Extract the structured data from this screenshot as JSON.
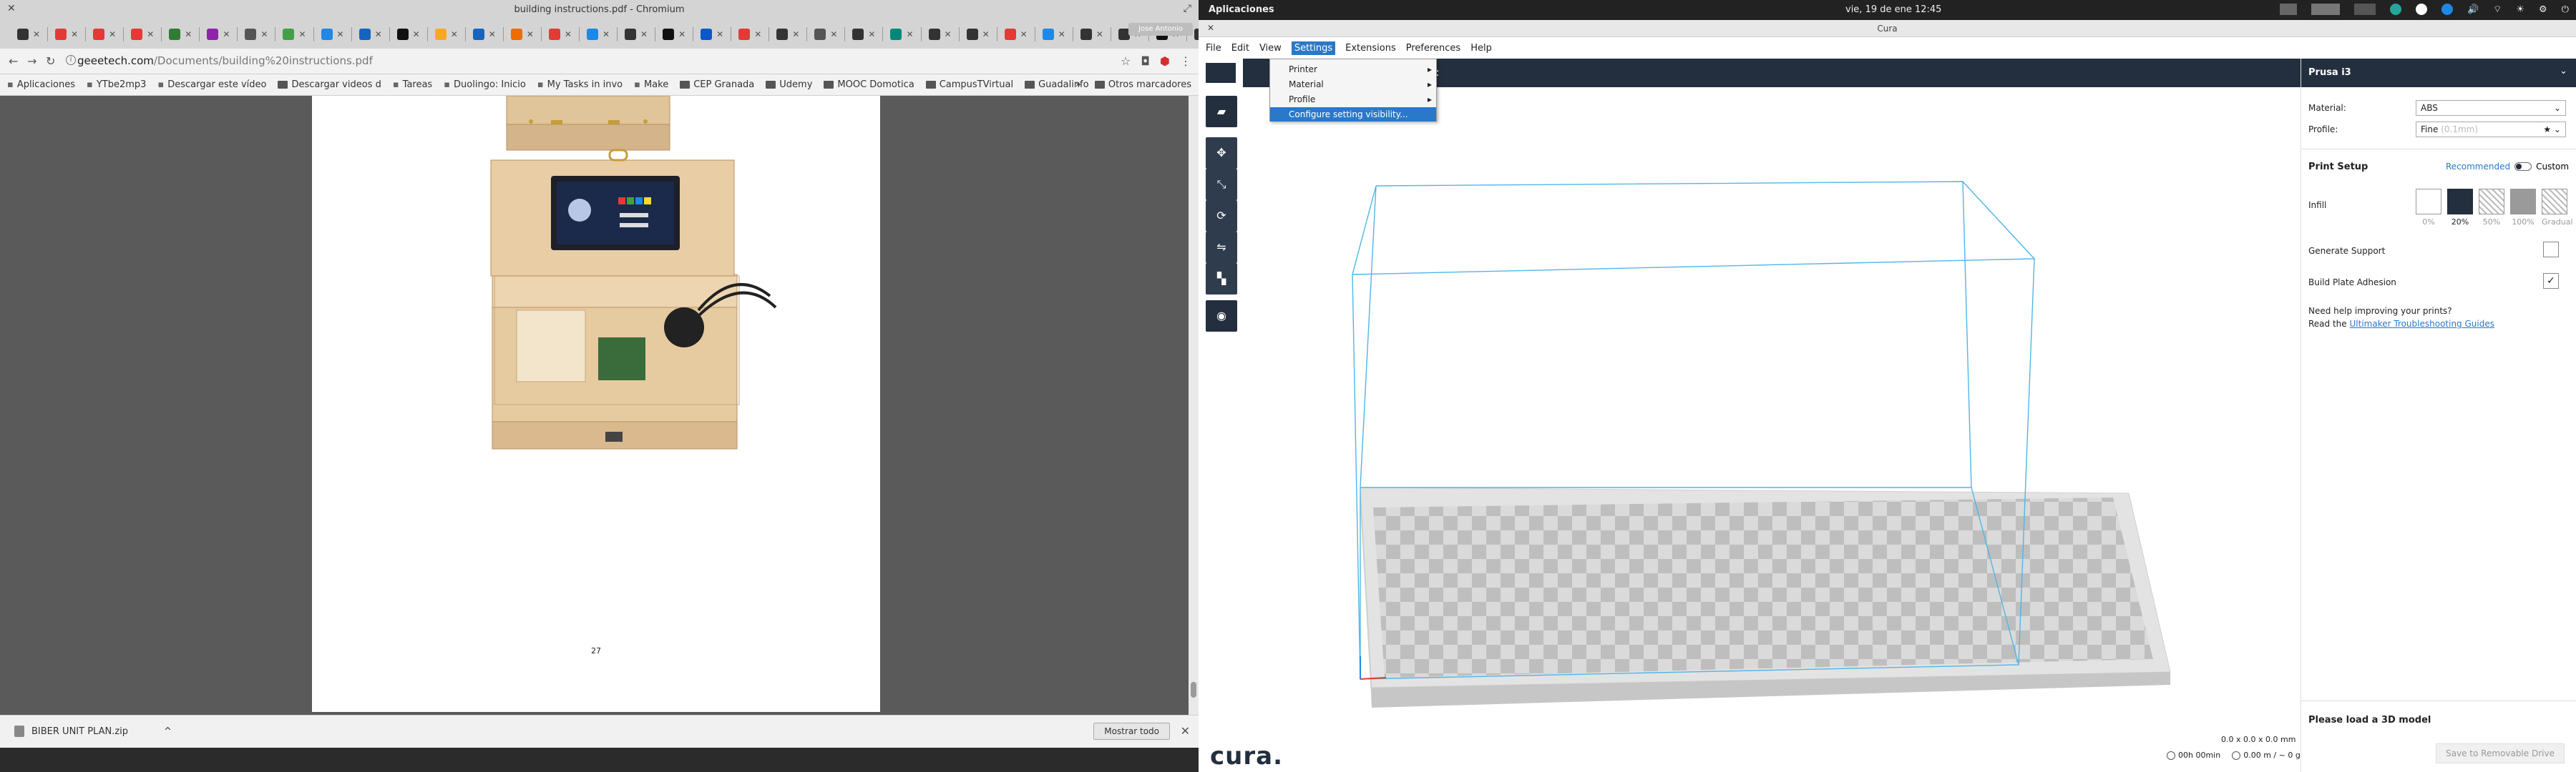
{
  "browser": {
    "window_title": "building instructions.pdf - Chromium",
    "user_label": "Jose Antonio",
    "url_host": "geeetech.com",
    "url_path": "/Documents/building%20instructions.pdf",
    "bookmarks": [
      {
        "label": "Aplicaciones",
        "icon": "apps-icon"
      },
      {
        "label": "YTbe2mp3",
        "icon": "page-icon"
      },
      {
        "label": "Descargar este vídeo",
        "icon": "page-icon"
      },
      {
        "label": "Descargar videos d",
        "icon": "folder-icon"
      },
      {
        "label": "Tareas",
        "icon": "check-icon"
      },
      {
        "label": "Duolingo: Inicio",
        "icon": "duolingo-icon"
      },
      {
        "label": "My Tasks in invo",
        "icon": "tasks-icon"
      },
      {
        "label": "Make",
        "icon": "make-icon"
      },
      {
        "label": "CEP Granada",
        "icon": "folder-icon"
      },
      {
        "label": "Udemy",
        "icon": "folder-icon"
      },
      {
        "label": "MOOC Domotica",
        "icon": "folder-icon"
      },
      {
        "label": "CampusTVirtual",
        "icon": "folder-icon"
      },
      {
        "label": "Guadalinfo",
        "icon": "folder-icon"
      }
    ],
    "other_bookmarks": "Otros marcadores",
    "page_number": "27",
    "download_file": "BIBER UNIT PLAN.zip",
    "show_all": "Mostrar todo",
    "tab_colors": [
      "#333333",
      "#e53935",
      "#e53935",
      "#e53935",
      "#2e7d32",
      "#8e24aa",
      "#555555",
      "#43a047",
      "#1e88e5",
      "#1565c0",
      "#111111",
      "#f9a825",
      "#1565c0",
      "#ef6c00",
      "#e53935",
      "#1e88e5",
      "#333333",
      "#111111",
      "#0b57d0",
      "#e53935",
      "#333333",
      "#555555",
      "#333333",
      "#00897b",
      "#333333",
      "#333333",
      "#e53935",
      "#1e88e5",
      "#333333",
      "#333333",
      "#111111",
      "#333333",
      "#e53935",
      "#e53935",
      "#e53935"
    ]
  },
  "system": {
    "apps_menu": "Aplicaciones",
    "clock": "vie, 19 de ene   12:45"
  },
  "cura": {
    "window_title": "Cura",
    "menu": [
      "File",
      "Edit",
      "View",
      "Settings",
      "Extensions",
      "Preferences",
      "Help"
    ],
    "header_tab": "nt",
    "settings_menu": [
      {
        "label": "Printer",
        "has_sub": true
      },
      {
        "label": "Material",
        "has_sub": true
      },
      {
        "label": "Profile",
        "has_sub": true
      },
      {
        "label": "Configure setting visibility...",
        "has_sub": false
      }
    ],
    "printer_name": "Prusa i3",
    "material_label": "Material:",
    "material_value": "ABS",
    "profile_label": "Profile:",
    "profile_value": "Fine",
    "profile_hint": "(0.1mm)",
    "print_setup": "Print Setup",
    "mode_recommended": "Recommended",
    "mode_custom": "Custom",
    "infill_label": "Infill",
    "infill_options": [
      "0%",
      "20%",
      "50%",
      "100%",
      "Gradual"
    ],
    "infill_selected": 1,
    "generate_support": "Generate Support",
    "generate_support_checked": false,
    "build_plate_adhesion": "Build Plate Adhesion",
    "build_plate_adhesion_checked": true,
    "help_line1": "Need help improving your prints?",
    "help_line2": "Read the",
    "help_link": "Ultimaker Troubleshooting Guides",
    "load_model": "Please load a 3D model",
    "save_button": "Save to Removable Drive",
    "brand": "cura.",
    "dimensions": "0.0 x 0.0 x 0.0 mm",
    "print_time": "00h 00min",
    "material_usage": "0.00 m / ~ 0 g",
    "accent_color": "#232f3e",
    "link_color": "#2a78c8"
  }
}
